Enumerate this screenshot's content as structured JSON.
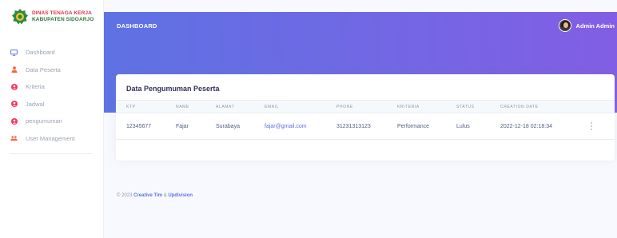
{
  "brand": {
    "line1": "DINAS TENAGA KERJA",
    "line2": "KABUPATEN SIDOARJO"
  },
  "sidebar": {
    "items": [
      {
        "label": "Dashboard",
        "icon": "tv-icon",
        "color": "#5e72e4"
      },
      {
        "label": "Data Peserta",
        "icon": "user-icon",
        "color": "#fb6340"
      },
      {
        "label": "Kriteria",
        "icon": "user-circle-icon",
        "color": "#f5365c"
      },
      {
        "label": "Jadwal",
        "icon": "user-circle-icon",
        "color": "#f5365c"
      },
      {
        "label": "pengumuman",
        "icon": "user-circle-icon",
        "color": "#f5365c"
      },
      {
        "label": "User Management",
        "icon": "users-icon",
        "color": "#fb6340"
      }
    ]
  },
  "header": {
    "title": "DASHBOARD",
    "user_name": "Admin Admin"
  },
  "card": {
    "title": "Data Pengumuman Peserta",
    "columns": [
      "KTP",
      "NAME",
      "ALAMAT",
      "EMAIL",
      "PHONE",
      "KRITERIA",
      "STATUS",
      "CREATION DATE"
    ],
    "rows": [
      {
        "ktp": "12345677",
        "name": "Fajar",
        "alamat": "Surabaya",
        "email": "fajar@gmail.com",
        "phone": "31231313123",
        "kriteria": "Performance",
        "status": "Lulus",
        "creation_date": "2022-12-18 02:18:34"
      }
    ]
  },
  "footer": {
    "prefix": "© 2023",
    "link1": "Creative Tim",
    "sep": "&",
    "link2": "Updivision"
  },
  "colors": {
    "primary": "#5e72e4",
    "gradient_end": "#825ee4",
    "danger": "#f5365c",
    "warning": "#fb6340"
  }
}
